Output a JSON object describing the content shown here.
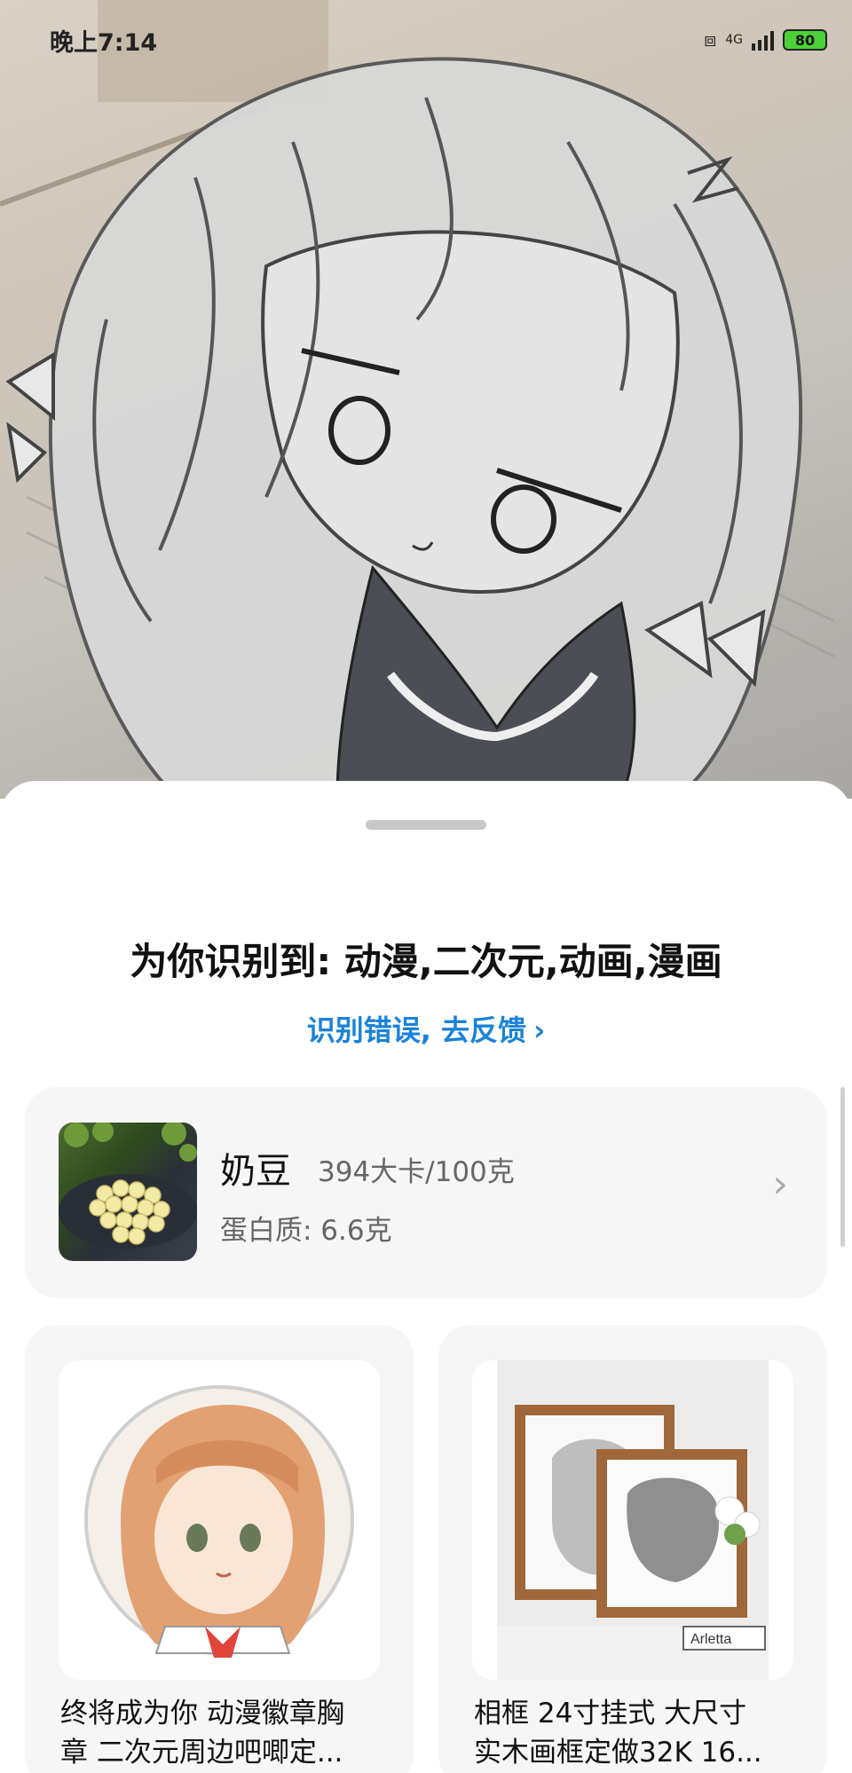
{
  "status_bar": {
    "time": "晚上7:14",
    "network_label": "4G",
    "battery_level": "80"
  },
  "hero": {
    "image_description_icon": "anime-sketch-image"
  },
  "sheet": {
    "result_title": "为你识别到: 动漫,二次元,动画,漫画",
    "feedback_link": "识别错误, 去反馈",
    "feedback_chevron": "›"
  },
  "food_card": {
    "name": "奶豆",
    "calories": "394大卡/100克",
    "protein": "蛋白质: 6.6克",
    "chevron": "›"
  },
  "products": [
    {
      "title_line1": "终将成为你 动漫徽章胸",
      "title_line2": "章 二次元周边吧唧定..."
    },
    {
      "title_line1": "相框 24寸挂式 大尺寸",
      "title_line2": "实木画框定做32K 16...",
      "frame_tag": "Arletta"
    }
  ],
  "colors": {
    "accent_link": "#1a82d8",
    "battery_fill": "#4cd137",
    "card_bg": "#f6f6f6"
  }
}
